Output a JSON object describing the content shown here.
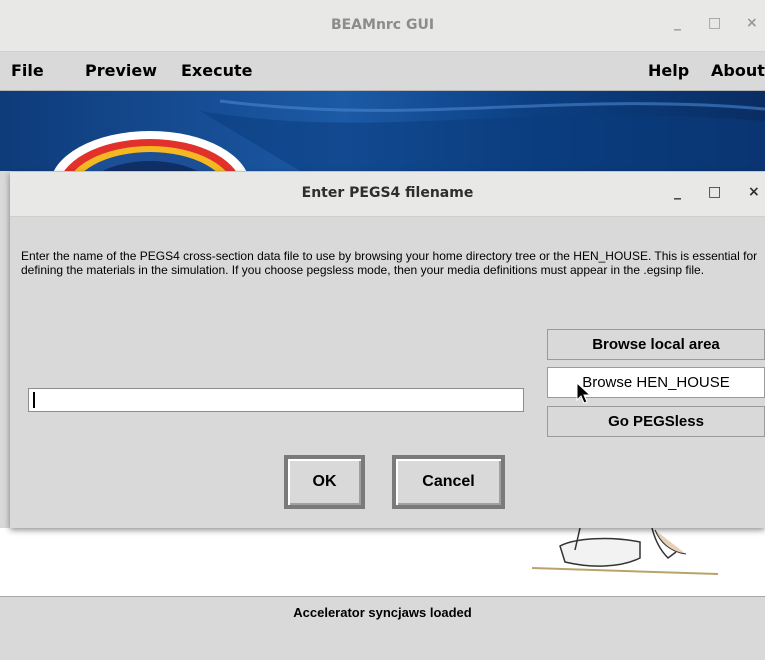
{
  "window": {
    "title": "BEAMnrc GUI",
    "controls": {
      "minimize": "_",
      "maximize": "□",
      "close": "×"
    }
  },
  "menu": {
    "left": [
      "File",
      "Preview",
      "Execute"
    ],
    "right": [
      "Help",
      "About"
    ]
  },
  "dialog": {
    "title": "Enter PEGS4 filename",
    "controls": {
      "minimize": "_",
      "maximize": "□",
      "close": "×"
    },
    "description": "Enter the name of the PEGS4 cross-section data file to use by browsing your home directory tree or the HEN_HOUSE. This is essential for defining the materials in the simulation. If you choose pegsless mode, then your media definitions must appear in the .egsinp file.",
    "input": {
      "value": ""
    },
    "side_buttons": {
      "browse_local": "Browse local area",
      "browse_hen": "Browse HEN_HOUSE",
      "pegsless": "Go PEGSless"
    },
    "ok": "OK",
    "cancel": "Cancel"
  },
  "status": {
    "text": "Accelerator syncjaws loaded"
  },
  "colors": {
    "window_bg": "#d9d9d9",
    "titlebar_bg": "#e8e8e7",
    "banner_blue": "#1c5aa6"
  }
}
